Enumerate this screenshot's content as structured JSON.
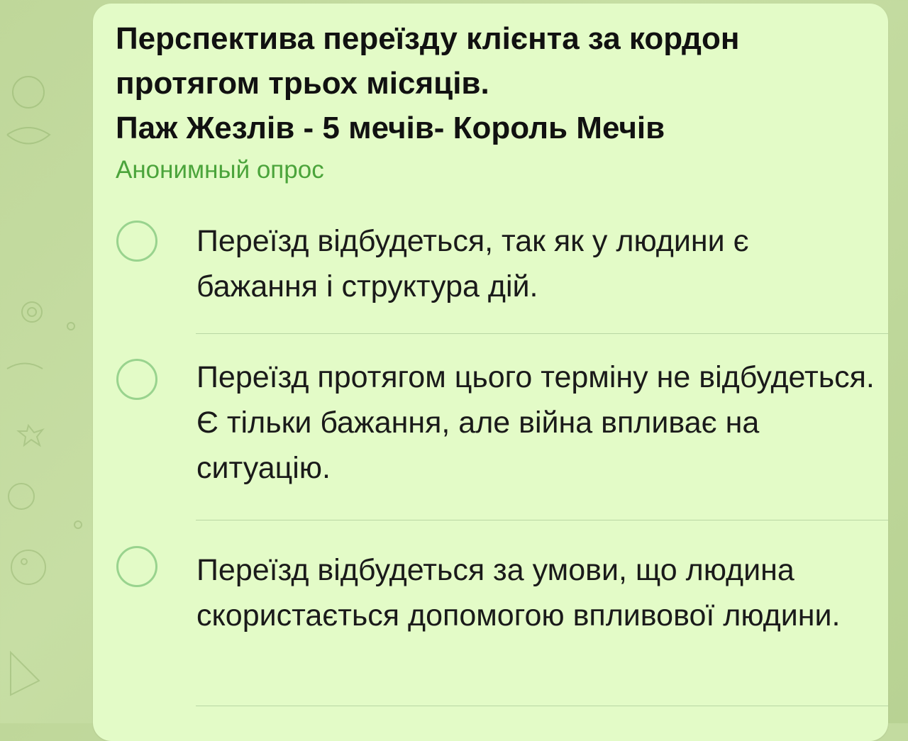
{
  "poll": {
    "question_lines": [
      "Перспектива переїзду клієнта за кордон",
      "протягом трьох місяців.",
      "Паж Жезлів - 5 мечів- Король Мечів"
    ],
    "type_label": "Анонимный опрос",
    "options": [
      {
        "text": "Переїзд відбудеться, так як у людини є бажання і структура дій."
      },
      {
        "text": "Переїзд протягом цього терміну не відбудеться. Є тільки бажання, але війна впливає на ситуацію."
      },
      {
        "text": "Переїзд відбудеться за умови, що людина скористається допомогою впливової людини."
      }
    ]
  },
  "colors": {
    "bubble": "#e3fbc7",
    "accent": "#4ba43b",
    "radio_border": "#99d38e",
    "wallpaper": "#c1d99c"
  },
  "icons": {
    "wallpaper": "doodle-pattern",
    "radio": "empty-radio-circle"
  }
}
